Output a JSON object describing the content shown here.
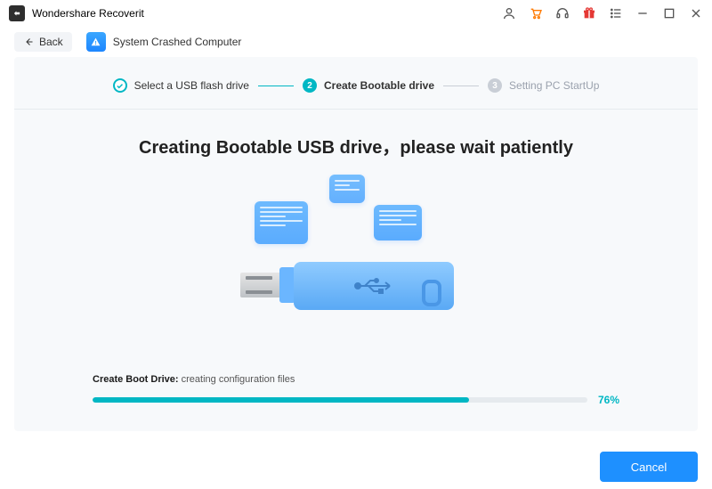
{
  "app": {
    "title": "Wondershare Recoverit"
  },
  "toolbar": {
    "back_label": "Back",
    "section_label": "System Crashed Computer"
  },
  "steps": [
    {
      "num": "✓",
      "label": "Select a USB flash drive",
      "state": "done"
    },
    {
      "num": "2",
      "label": "Create Bootable drive",
      "state": "active"
    },
    {
      "num": "3",
      "label": "Setting PC StartUp",
      "state": "inactive"
    }
  ],
  "main": {
    "heading": "Creating Bootable USB drive，please wait patiently"
  },
  "progress": {
    "label_strong": "Create Boot Drive:",
    "label_status": " creating configuration files",
    "percent_text": "76%",
    "percent_value": 76
  },
  "footer": {
    "cancel_label": "Cancel"
  },
  "icons": {
    "back": "arrow-left-icon",
    "section": "warning-icon",
    "user": "user-icon",
    "cart": "cart-icon",
    "support": "headset-icon",
    "gift": "gift-icon",
    "menu": "list-icon",
    "minimize": "minimize-icon",
    "maximize": "maximize-icon",
    "close": "close-icon"
  },
  "colors": {
    "accent_teal": "#00b7c4",
    "accent_blue": "#1e90ff",
    "panel_bg": "#f7f9fb",
    "cart_orange": "#ff7a00",
    "gift_red": "#e53935"
  }
}
